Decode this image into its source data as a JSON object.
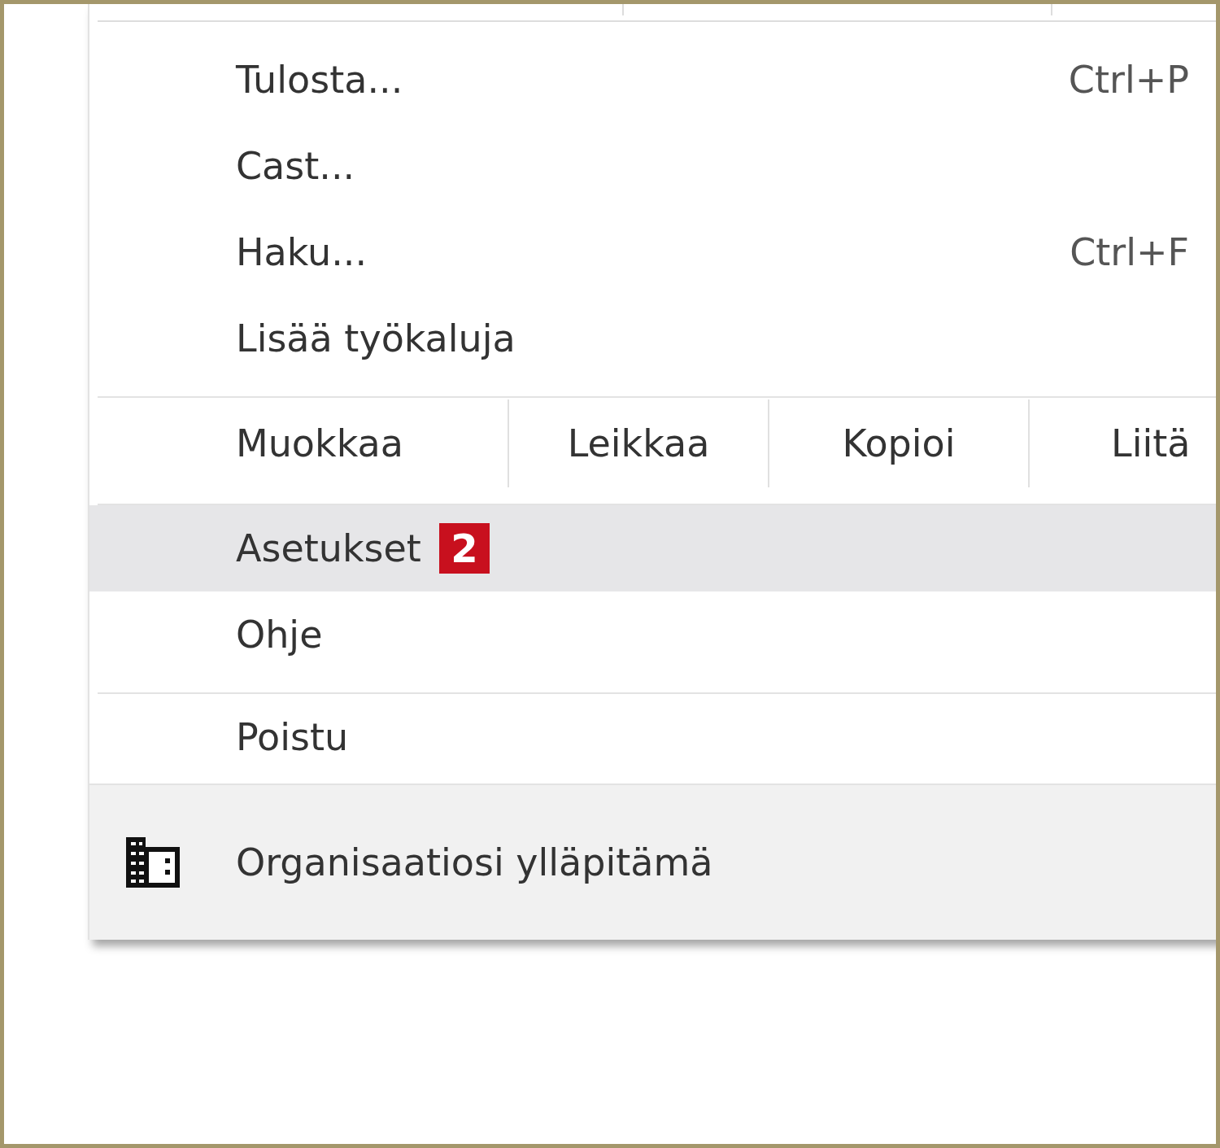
{
  "menu": {
    "items": [
      {
        "kind": "item",
        "label": "Tulosta...",
        "shortcut": "Ctrl+P",
        "selected": false
      },
      {
        "kind": "item",
        "label": "Cast...",
        "selected": false
      },
      {
        "kind": "item",
        "label": "Haku...",
        "shortcut": "Ctrl+F",
        "selected": false
      },
      {
        "kind": "item",
        "label": "Lisää työkaluja",
        "selected": false
      },
      {
        "kind": "separator"
      },
      {
        "kind": "edit",
        "label": "Muokkaa",
        "buttons": [
          "Leikkaa",
          "Kopioi",
          "Liitä"
        ]
      },
      {
        "kind": "separator"
      },
      {
        "kind": "item",
        "label": "Asetukset",
        "badge": "2",
        "selected": true
      },
      {
        "kind": "item",
        "label": "Ohje",
        "selected": false
      },
      {
        "kind": "separator"
      },
      {
        "kind": "item",
        "label": "Poistu",
        "selected": false
      }
    ],
    "footer": {
      "label": "Organisaatiosi ylläpitämä"
    }
  }
}
